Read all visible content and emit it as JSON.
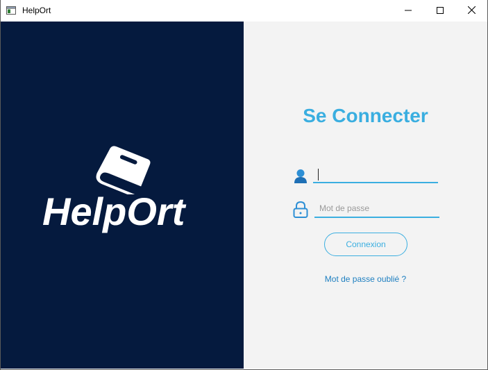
{
  "window": {
    "title": "HelpOrt",
    "controls": {
      "minimize": "minimize-icon",
      "maximize": "maximize-icon",
      "close": "close-icon"
    }
  },
  "brand": {
    "name": "HelpOrt",
    "logo_icon": "book-icon",
    "background_color": "#051a3e",
    "text_color": "#ffffff"
  },
  "login": {
    "heading": "Se Connecter",
    "username": {
      "icon": "user-icon",
      "value": "",
      "placeholder": ""
    },
    "password": {
      "icon": "lock-icon",
      "value": "",
      "placeholder": "Mot de passe"
    },
    "submit_label": "Connexion",
    "forgot_label": "Mot de passe oublié ?",
    "accent_color": "#3aaee0",
    "panel_background": "#f3f3f3"
  }
}
